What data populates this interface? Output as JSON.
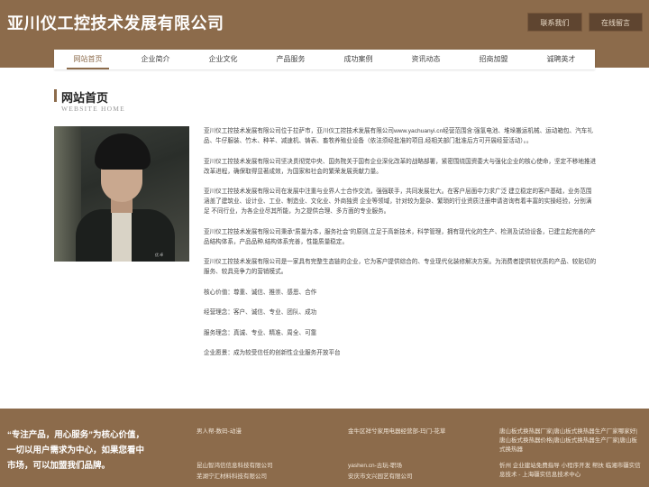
{
  "header": {
    "logo": "亚川仪工控技术发展有限公司",
    "contact_label": "联系我们",
    "message_label": "在线留言"
  },
  "nav": {
    "items": [
      "网站首页",
      "企业简介",
      "企业文化",
      "产品服务",
      "成功案例",
      "资讯动态",
      "招商加盟",
      "诚聘英才"
    ],
    "active_index": 0
  },
  "section": {
    "title": "网站首页",
    "subtitle": "WEBSITE HOME"
  },
  "photo": {
    "caption": "优.卓"
  },
  "content": {
    "paragraphs": [
      "亚川仪工控技术发展有限公司位于拉萨市，亚川仪工控技术发展有限公司www.yachuanyi.cn经营范围含:强氢电池、堆垛搬运机械、运动箱包、汽车礼品、牛仔服装、竹木、种羊、减速机、铸表、畜牧养殖业设备（依法须经批准的项目,经相关部门批准后方可开展经营活动）。。",
      "亚川仪工控技术发展有限公司坚决贯彻党中央、国务院关于国有企业深化改革的战略部署，紧密围绕国资委大与强化企业的核心使命，坚定不移地推进改革进程，确保取得显著成效，为国家和社会的繁荣发展贡献力量。",
      "亚川仪工控技术发展有限公司在发展中注重与业界人士合作交流，强强联手，共同发展壮大。在客户层面中力求广泛 建立稳定的客户基础，业务范围涵盖了建筑业、设计业、工业、制造业、文化业、外商独资 企业等领域，针对较为复杂、繁琐的行业资质注册申请咨询有着丰富的实操经验，分别满足 不同行业，为各企业尽其所能，为之提供合理、多方面的专业服务。",
      "亚川仪工控技术发展有限公司秉承“质量为本，服务社会”的原则,立足于高新技术，科学管理，拥有现代化的生产、检测及试验设备，已建立起完善的产品结构体系，产品品种,结构体系完善，性能质量稳定。",
      "亚川仪工控技术发展有限公司是一家具有完整生态链的企业，它为客户提供综合的、专业现代化装修解决方案。为消费者提供较优质的产品、较贴切的服务、较具竞争力的营销模式。"
    ],
    "values": [
      "核心价值：尊重、诚信、推崇、感恩、合作",
      "经营理念：客户、诚信、专业、团队、成功",
      "服务理念：真诚、专业、精准、周全、可靠",
      "企业愿景：成为较受信任的创新性企业服务开放平台"
    ]
  },
  "footer": {
    "slogan": "“专注产品，用心服务”为核心价值，一切以用户需求为中心，如果您看中市场，可以加盟我们品牌。",
    "col1": [
      "男人帮-数码-动漫",
      "昆山智鸿信信息科技有限公司",
      "芜湖宁汇材料科技有限公司"
    ],
    "col2": [
      "金牛区祥兮家用电器经营部-玛门-花草",
      "yashen.cn-古玩-职场",
      "安庆市文兴园艺有限公司"
    ],
    "col3": [
      "唐山板式换热器厂家|唐山板式换热器生产厂家哪家好|唐山板式换热器价格|唐山板式换热器生产厂家|唐山板式换热器",
      "忻州 企业建站免费指导 小程序开发 帮扶 临湘市疆实信息技术 - 上海疆实信息技术中心"
    ]
  },
  "colors": {
    "brand": "#8c6b4b",
    "button": "#5f4530"
  }
}
